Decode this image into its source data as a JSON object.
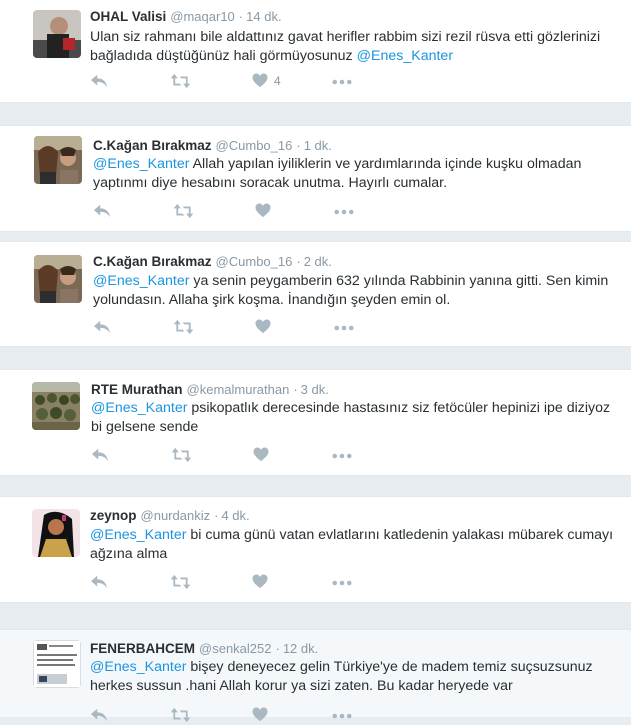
{
  "tweets": [
    {
      "name": "OHAL Valisi",
      "handle": "@maqar10",
      "time": "14 dk.",
      "mention": "@Enes_Kanter",
      "text_before": "Ulan siz rahmanı bile aldattınız gavat herifler rabbim sizi rezil rüsva etti gözlerinizi bağladıda düştüğünüz hali görmüyosunuz ",
      "text_after": "",
      "like_count": "4"
    },
    {
      "name": "C.Kağan Bırakmaz",
      "handle": "@Cumbo_16",
      "time": "1 dk.",
      "mention": "@Enes_Kanter",
      "text_before": "",
      "text_after": " Allah yapılan iyiliklerin ve yardımlarında içinde kuşku olmadan yaptınmı diye hesabını soracak unutma. Hayırlı cumalar.",
      "like_count": ""
    },
    {
      "name": "C.Kağan Bırakmaz",
      "handle": "@Cumbo_16",
      "time": "2 dk.",
      "mention": "@Enes_Kanter",
      "text_before": "",
      "text_after": " ya senin peygamberin 632 yılında Rabbinin yanına gitti. Sen kimin yolundasın. Allaha şirk koşma. İnandığın şeyden emin ol.",
      "like_count": ""
    },
    {
      "name": "RTE Murathan",
      "handle": "@kemalmurathan",
      "time": "3 dk.",
      "mention": "@Enes_Kanter",
      "text_before": "",
      "text_after": " psikopatlık derecesinde hastasınız siz fetöcüler hepinizi ipe diziyoz bi gelsene sende",
      "like_count": ""
    },
    {
      "name": "zeynop",
      "handle": "@nurdankiz",
      "time": "4 dk.",
      "mention": "@Enes_Kanter",
      "text_before": "",
      "text_after": " bi cuma günü vatan evlatlarını katledenin yalakası mübarek cumayı ağzına alma",
      "like_count": ""
    },
    {
      "name": "FENERBAHCEM",
      "handle": "@senkal252",
      "time": "12 dk.",
      "mention": "@Enes_Kanter",
      "text_before": "",
      "text_after": " bişey deneyecez gelin Türkiye'ye de madem temiz suçsuzsunuz herkes sussun .hani Allah korur ya sizi zaten. Bu kadar heryede var",
      "like_count": ""
    }
  ],
  "dot_separator": "·",
  "icons": [
    "reply-icon",
    "retweet-icon",
    "like-icon",
    "more-icon"
  ],
  "colors": {
    "mention": "#1b95e0",
    "meta": "#8899a6",
    "icon": "#aab8c2"
  }
}
